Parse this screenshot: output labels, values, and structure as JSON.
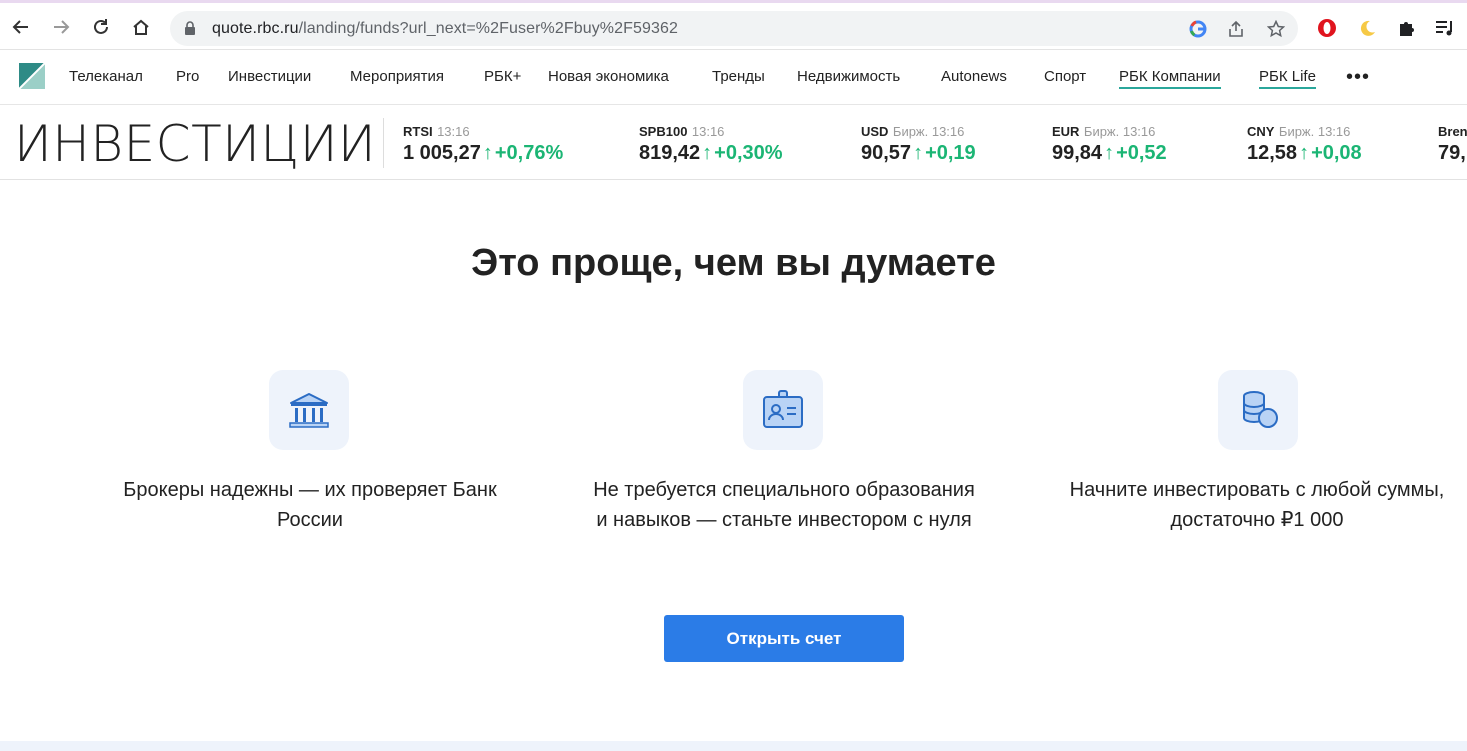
{
  "browser": {
    "url_host": "quote.rbc.ru",
    "url_path": "/landing/funds?url_next=%2Fuser%2Fbuy%2F59362"
  },
  "nav": {
    "items": [
      {
        "label": "Телеканал"
      },
      {
        "label": "Pro"
      },
      {
        "label": "Инвестиции"
      },
      {
        "label": "Мероприятия"
      },
      {
        "label": "РБК+"
      },
      {
        "label": "Новая экономика"
      },
      {
        "label": "Тренды"
      },
      {
        "label": "Недвижимость"
      },
      {
        "label": "Autonews"
      },
      {
        "label": "Спорт"
      },
      {
        "label": "РБК Компании"
      },
      {
        "label": "РБК Life"
      }
    ],
    "more": "•••"
  },
  "brand": {
    "title": "ИНВЕСТИЦИИ"
  },
  "tickers": [
    {
      "name": "RTSI",
      "time": "13:16",
      "value": "1 005,27",
      "arrow": "↑",
      "change": "+0,76%"
    },
    {
      "name": "SPB100",
      "time": "13:16",
      "value": "819,42",
      "arrow": "↑",
      "change": "+0,30%"
    },
    {
      "name": "USD",
      "time": "Бирж. 13:16",
      "value": "90,57",
      "arrow": "↑",
      "change": "+0,19"
    },
    {
      "name": "EUR",
      "time": "Бирж. 13:16",
      "value": "99,84",
      "arrow": "↑",
      "change": "+0,52"
    },
    {
      "name": "CNY",
      "time": "Бирж. 13:16",
      "value": "12,58",
      "arrow": "↑",
      "change": "+0,08"
    },
    {
      "name": "Brent",
      "time": "",
      "value": "79,",
      "arrow": "",
      "change": ""
    }
  ],
  "main": {
    "headline": "Это проще, чем вы думаете",
    "features": [
      {
        "icon": "bank-icon",
        "line1": "Брокеры надежны — их проверяет Банк",
        "line2": "России"
      },
      {
        "icon": "id-card-icon",
        "line1": "Не требуется специального образования",
        "line2": "и навыков — станьте инвестором с нуля"
      },
      {
        "icon": "coins-icon",
        "line1": "Начните инвестировать с любой суммы,",
        "line2": "достаточно ₽1 000"
      }
    ],
    "cta_label": "Открыть счет"
  },
  "colors": {
    "accent": "#2b7ce7",
    "positive": "#1bb574",
    "nav_underline": "#2aa79b",
    "icon_bg": "#eef3fb"
  }
}
